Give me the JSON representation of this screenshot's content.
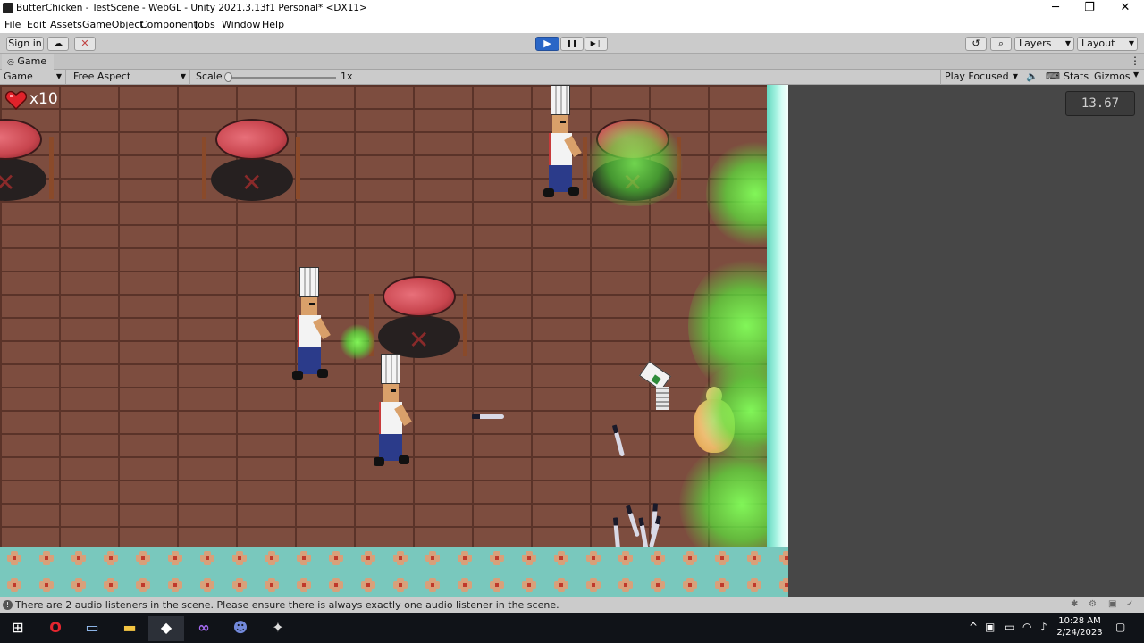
{
  "window": {
    "title": "ButterChicken - TestScene - WebGL - Unity 2021.3.13f1 Personal* <DX11>",
    "controls": {
      "minimize": "─",
      "maximize": "❐",
      "close": "✕"
    }
  },
  "menu": [
    "File",
    "Edit",
    "Assets",
    "GameObject",
    "Component",
    "Jobs",
    "Window",
    "Help"
  ],
  "toolbar": {
    "sign_in": "Sign in",
    "cloud_icon": "☁",
    "collab_icon": "✕",
    "play_icon": "▶",
    "pause_icon": "❚❚",
    "step_icon": "▶❘",
    "history_icon": "↺",
    "search_icon": "⌕",
    "layers": "Layers",
    "layout": "Layout"
  },
  "game_tab": {
    "label": "Game",
    "display": "Game",
    "aspect": "Free Aspect",
    "scale_label": "Scale",
    "scale_value": "1x",
    "play_focused": "Play Focused",
    "stats": "Stats",
    "gizmos": "Gizmos"
  },
  "hud": {
    "lives": "x10",
    "fps": "13.67"
  },
  "status": {
    "message": "There are 2 audio listeners in the scene. Please ensure there is always exactly one audio listener in the scene."
  },
  "taskbar": {
    "time": "10:28 AM",
    "date": "2/24/2023",
    "apps": [
      "start-icon",
      "opera-icon",
      "explorer-window-icon",
      "file-explorer-icon",
      "unity-icon",
      "visual-studio-icon",
      "discord-icon",
      "game-tool-icon"
    ]
  },
  "colors": {
    "floor": "#7d4d3f",
    "wall": "#9ef0de",
    "play_active": "#2a66c6",
    "glow": "#82ff5a"
  }
}
